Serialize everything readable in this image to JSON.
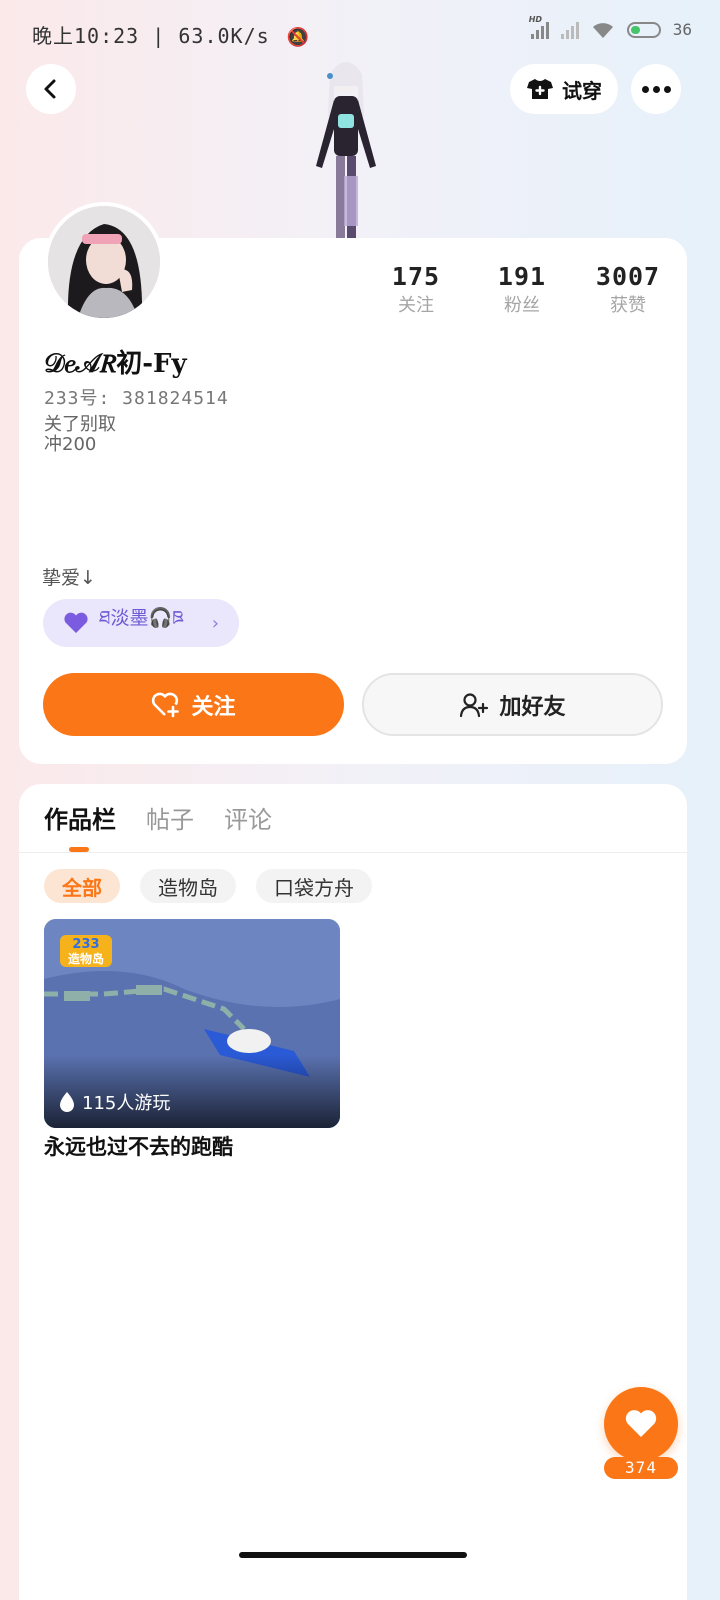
{
  "status_bar": {
    "time": "晚上10:23",
    "net_speed": "63.0K/s",
    "hd_badge": "HD",
    "battery_level": "36",
    "battery_fraction": 0.36
  },
  "header": {
    "try_on_label": "试穿"
  },
  "profile": {
    "username": "𝒟𝑒𝒜𝑅初-Fy",
    "uid_label": "233号: 381824514",
    "bio": "关了别取\n冲200",
    "stats": [
      {
        "value": "175",
        "label": "关注"
      },
      {
        "value": "191",
        "label": "粉丝"
      },
      {
        "value": "3007",
        "label": "获赞"
      }
    ],
    "love_label": "挚爱↓",
    "partner_name": "ཐ淡墨🎧ཋ",
    "follow_label": "关注",
    "add_friend_label": "加好友"
  },
  "works": {
    "tabs": [
      {
        "label": "作品栏",
        "active": true
      },
      {
        "label": "帖子",
        "active": false
      },
      {
        "label": "评论",
        "active": false
      }
    ],
    "filters": [
      {
        "label": "全部",
        "active": true
      },
      {
        "label": "造物岛",
        "active": false
      },
      {
        "label": "口袋方舟",
        "active": false
      }
    ],
    "items": [
      {
        "badge_number": "233",
        "badge_text": "造物岛",
        "plays_label": "115人游玩",
        "title": "永远也过不去的跑酷"
      }
    ]
  },
  "likes": {
    "count": "374"
  },
  "colors": {
    "accent": "#fb7616",
    "partner_chip_bg": "#eae6fb",
    "partner_text": "#6d5ad4"
  }
}
